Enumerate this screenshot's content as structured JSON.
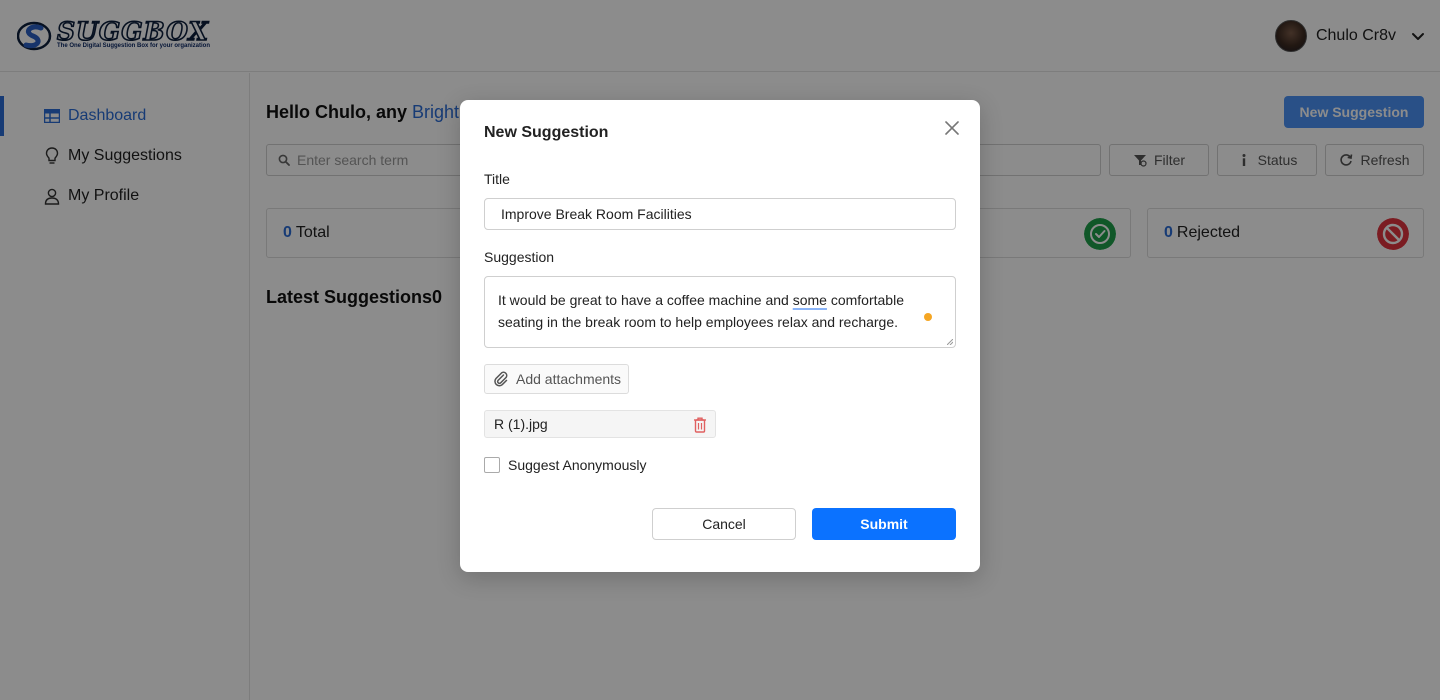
{
  "brand": {
    "name": "SUGGBOX",
    "tagline": "The One Digital Suggestion Box for your organization"
  },
  "header": {
    "user_name": "Chulo Cr8v",
    "avatar_icon": "avatar",
    "menu_icon": "chevron-down-icon"
  },
  "sidebar": {
    "items": [
      {
        "label": "Dashboard",
        "icon": "dashboard-icon",
        "active": true
      },
      {
        "label": "My Suggestions",
        "icon": "lightbulb-icon",
        "active": false
      },
      {
        "label": "My Profile",
        "icon": "user-icon",
        "active": false
      }
    ]
  },
  "main": {
    "greeting_prefix": "Hello Chulo, any ",
    "greeting_accent": "Bright",
    "new_suggestion_label": "New Suggestion",
    "search_placeholder": "Enter search term",
    "filter_label": "Filter",
    "status_label": "Status",
    "refresh_label": "Refresh",
    "cards": [
      {
        "count": "0",
        "label": "Total"
      },
      {
        "count": "0",
        "label": "Rejected"
      }
    ],
    "latest_title": "Latest Suggestions",
    "latest_count": "0"
  },
  "modal": {
    "title": "New Suggestion",
    "title_label": "Title",
    "title_value": "Improve Break Room Facilities",
    "suggestion_label": "Suggestion",
    "suggestion_before": "It would be great to have a coffee machine and ",
    "suggestion_flagged": "some",
    "suggestion_after": " comfortable seating in the break room to help employees relax and recharge.",
    "attach_label": "Add attachments",
    "file_name": "R (1).jpg",
    "anonymous_label": "Suggest Anonymously",
    "anonymous_checked": false,
    "cancel_label": "Cancel",
    "submit_label": "Submit"
  },
  "colors": {
    "accent": "#2b6cd6",
    "primary_button": "#0b72ff",
    "approved_badge": "#1e9e4a",
    "rejected_badge": "#e0343f",
    "grammar_dot": "#f5a623"
  }
}
